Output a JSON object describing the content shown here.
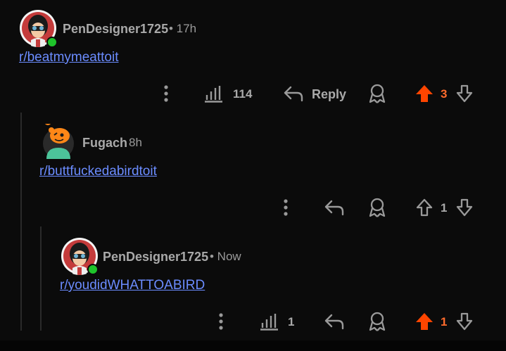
{
  "comments": [
    {
      "username": "PenDesigner1725",
      "time": "• 17h",
      "body": "r/beatmymeattoit",
      "views": "114",
      "reply_label": "Reply",
      "votes": "3",
      "upvoted": true,
      "online": true
    },
    {
      "username": "Fugach",
      "time": "8h",
      "body": "r/buttfuckedabirdtoit",
      "votes": "1",
      "upvoted": false,
      "online": false
    },
    {
      "username": "PenDesigner1725",
      "time": "• Now",
      "body": "r/youdidWHATTOABIRD",
      "views": "1",
      "votes": "1",
      "upvoted": true,
      "online": true
    }
  ],
  "colors": {
    "background": "#0b0b0b",
    "link": "#6b8cff",
    "upvote": "#ff4500",
    "online": "#1fc42b",
    "muted": "#9a9a9a"
  },
  "icons": [
    "more-icon",
    "views-chart-icon",
    "reply-arrow-icon",
    "award-icon",
    "upvote-icon",
    "downvote-icon"
  ]
}
